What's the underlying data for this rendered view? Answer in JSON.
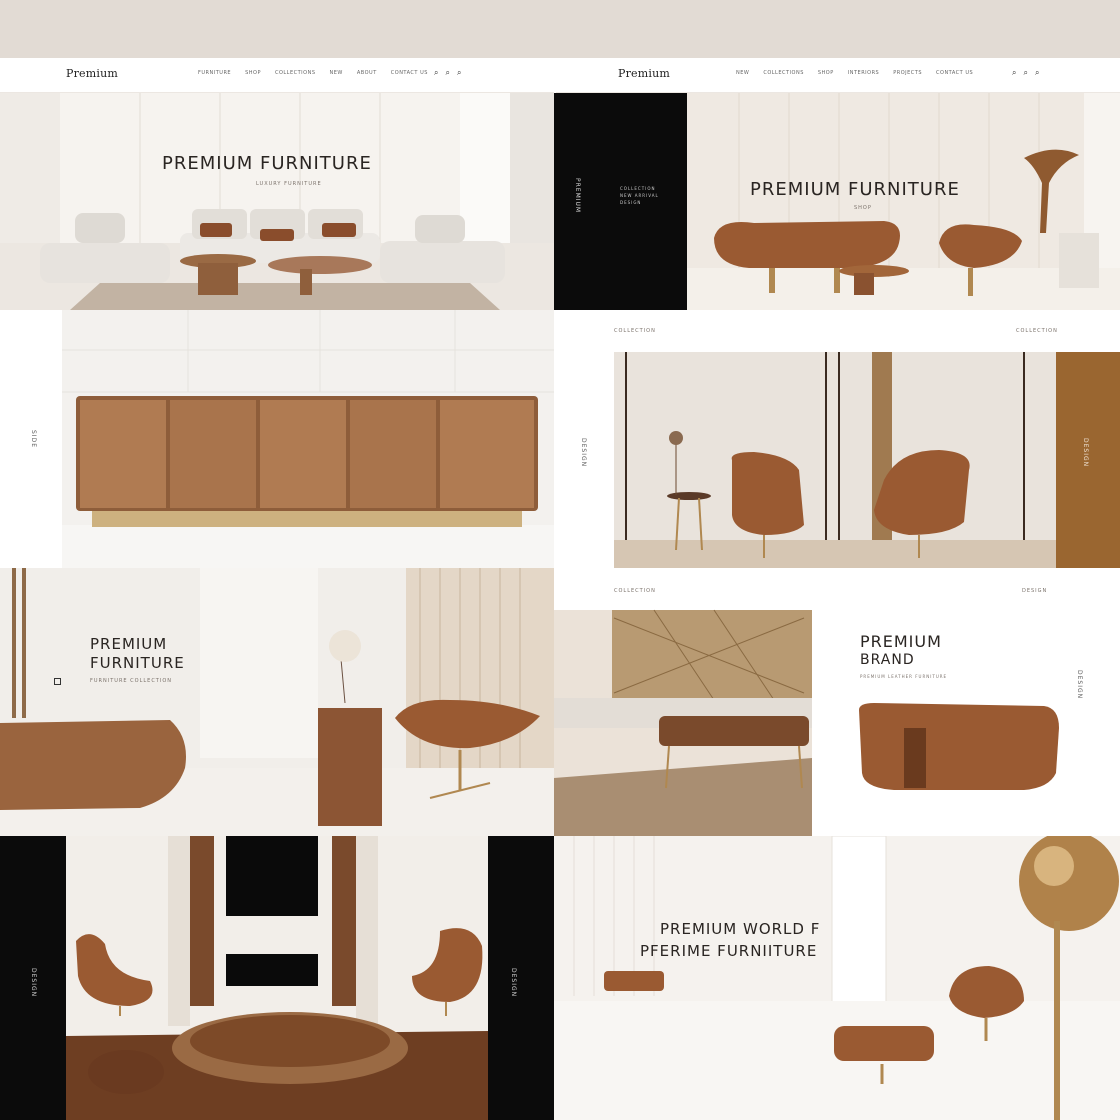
{
  "left_site": {
    "logo": "Premium",
    "nav": [
      "FURNITURE",
      "SHOP",
      "COLLECTIONS",
      "NEW",
      "ABOUT",
      "CONTACT US"
    ],
    "icons": [
      "search-icon",
      "zoom-icon",
      "user-icon"
    ]
  },
  "right_site": {
    "logo": "Premium",
    "nav": [
      "NEW",
      "COLLECTIONS",
      "SHOP",
      "INTERIORS",
      "PROJECTS",
      "CONTACT US"
    ],
    "icons": [
      "search-icon",
      "zoom-icon",
      "user-icon"
    ]
  },
  "panels": {
    "p1": {
      "title": "PREMIUM FURNITURE",
      "sub": "LUXURY FURNITURE"
    },
    "p2": {
      "title": "PREMIUM FURNITURE",
      "sub": "SHOP",
      "side_text": "PREMIUM",
      "side_small": "COLLECTION NEW ARRIVAL DESIGN"
    },
    "p3": {
      "side": "SIDE"
    },
    "p4": {
      "top_left": "COLLECTION",
      "top_right": "COLLECTION",
      "side": "DESIGN",
      "right_side": "DESIGN"
    },
    "p5": {
      "title_l1": "PREMIUM",
      "title_l2": "FURNITURE",
      "sub": "FURNITURE COLLECTION"
    },
    "p6": {
      "top_left": "COLLECTION",
      "top_right": "DESIGN",
      "title_l1": "PREMIUM",
      "title_l2": "BRAND",
      "sub": "PREMIUM LEATHER FURNITURE",
      "side": "DESIGN"
    },
    "p7": {
      "left_side": "DESIGN",
      "right_side": "DESIGN"
    },
    "p8": {
      "title_l1": "PREMIUM WORLD F",
      "title_l2": "PFERIME FURNIITURE"
    }
  },
  "colors": {
    "leather": "#9a5c34",
    "wood": "#a8724a",
    "cream": "#ebe6df",
    "black": "#0c0c0c",
    "band": "#e2dbd4",
    "gold": "#b08850"
  }
}
